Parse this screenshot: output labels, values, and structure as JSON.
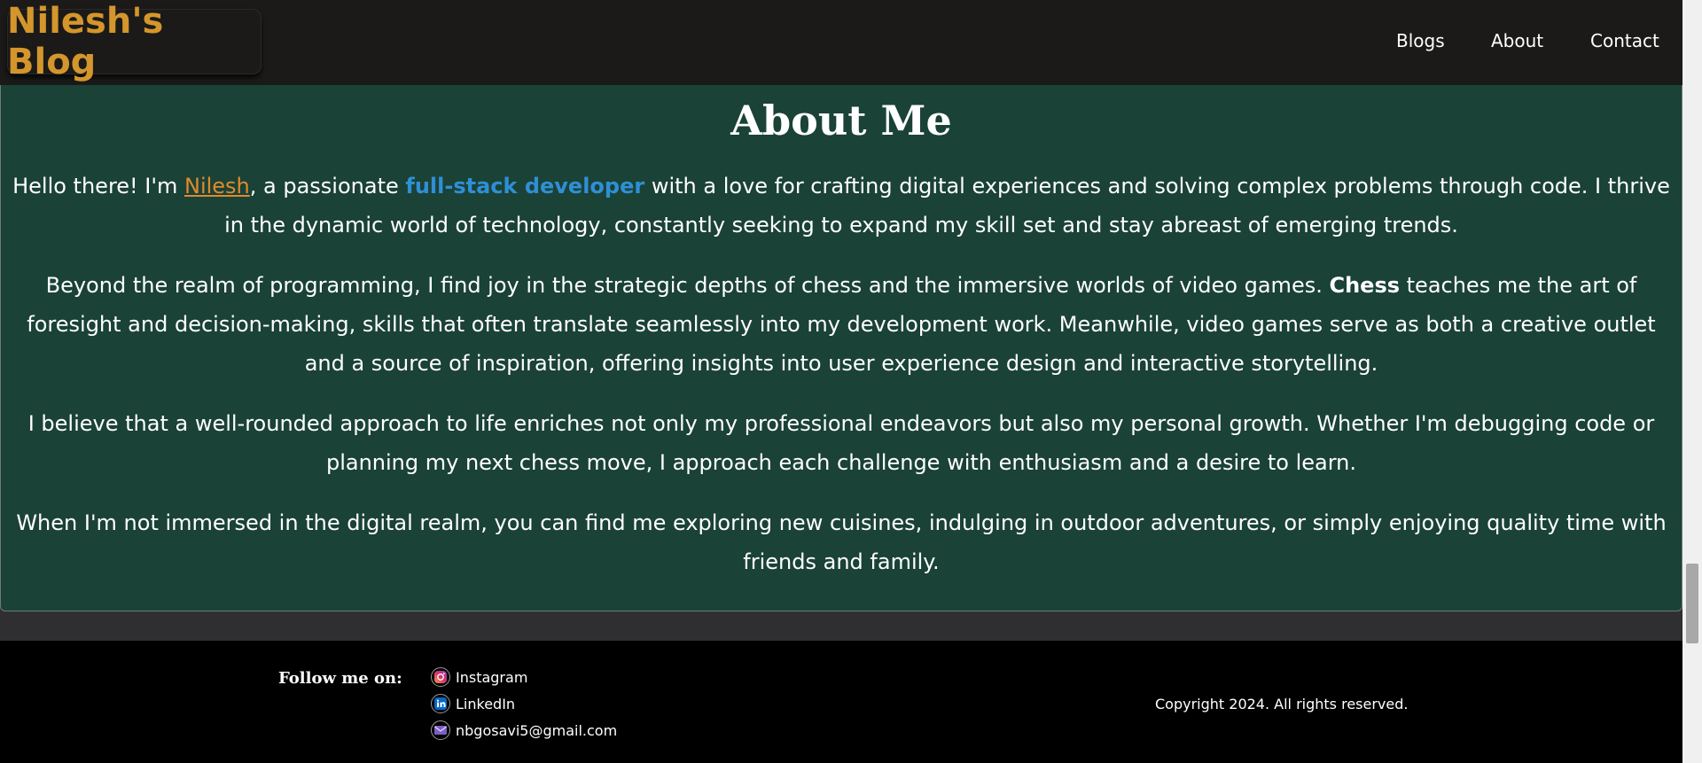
{
  "header": {
    "logo": "Nilesh's Blog",
    "nav": [
      "Blogs",
      "About",
      "Contact"
    ]
  },
  "about": {
    "title": "About Me",
    "p1": {
      "before_name": "Hello there! I'm ",
      "name": "Nilesh",
      "mid": ", a passionate ",
      "role": "full-stack developer",
      "after": " with a love for crafting digital experiences and solving complex problems through code. I thrive in the dynamic world of technology, constantly seeking to expand my skill set and stay abreast of emerging trends."
    },
    "p2": {
      "before": "Beyond the realm of programming, I find joy in the strategic depths of chess and the immersive worlds of video games. ",
      "bold": "Chess",
      "after": " teaches me the art of foresight and decision-making, skills that often translate seamlessly into my development work. Meanwhile, video games serve as both a creative outlet and a source of inspiration, offering insights into user experience design and interactive storytelling."
    },
    "p3": "I believe that a well-rounded approach to life enriches not only my professional endeavors but also my personal growth. Whether I'm debugging code or planning my next chess move, I approach each challenge with enthusiasm and a desire to learn.",
    "p4": "When I'm not immersed in the digital realm, you can find me exploring new cuisines, indulging in outdoor adventures, or simply enjoying quality time with friends and family."
  },
  "footer": {
    "follow_label": "Follow me on:",
    "links": [
      {
        "label": "Instagram",
        "icon": "instagram-icon"
      },
      {
        "label": "LinkedIn",
        "icon": "linkedin-icon"
      },
      {
        "label": "nbgosavi5@gmail.com",
        "icon": "email-icon"
      }
    ],
    "copyright": "Copyright 2024. All rights reserved."
  },
  "colors": {
    "accent_orange": "#d4962c",
    "link_blue": "#2f8fd6",
    "section_green": "#1a4236"
  }
}
